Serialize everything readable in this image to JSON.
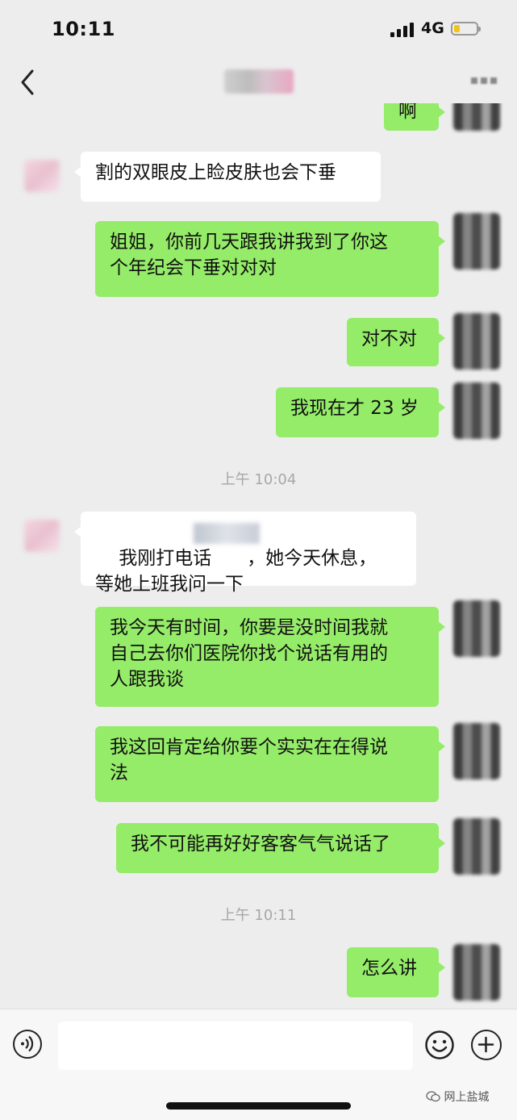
{
  "status_bar": {
    "time": "10:11",
    "network": "4G"
  },
  "icons": {
    "back": "chevron-left-icon",
    "more": "more-dots-icon",
    "voice": "voice-icon",
    "emoji": "emoji-icon",
    "plus": "plus-circle-icon",
    "watermark": "wechat-icon"
  },
  "colors": {
    "background": "#ededed",
    "outgoing_bubble": "#95ec69",
    "incoming_bubble": "#ffffff",
    "timestamp": "#a7a7a7"
  },
  "messages": [
    {
      "side": "right",
      "text": "啊"
    },
    {
      "side": "left",
      "text": "割的双眼皮上睑皮肤也会下垂"
    },
    {
      "side": "right",
      "text": "姐姐，你前几天跟我讲我到了你这\n个年纪会下垂对对对"
    },
    {
      "side": "right",
      "text": "对不对"
    },
    {
      "side": "right",
      "text": "我现在才 23 岁"
    },
    {
      "side": "left",
      "text": "我刚打电话      ，她今天休息，\n等她上班我问一下"
    },
    {
      "side": "right",
      "text": "我今天有时间，你要是没时间我就\n自己去你们医院你找个说话有用的\n人跟我谈"
    },
    {
      "side": "right",
      "text": "我这回肯定给你要个实实在在得说\n法"
    },
    {
      "side": "right",
      "text": "我不可能再好好客客气气说话了"
    },
    {
      "side": "right",
      "text": "怎么讲"
    }
  ],
  "timestamps": [
    "上午 10:04",
    "上午 10:11"
  ],
  "input": {
    "placeholder": ""
  },
  "watermark": "网上盐城"
}
